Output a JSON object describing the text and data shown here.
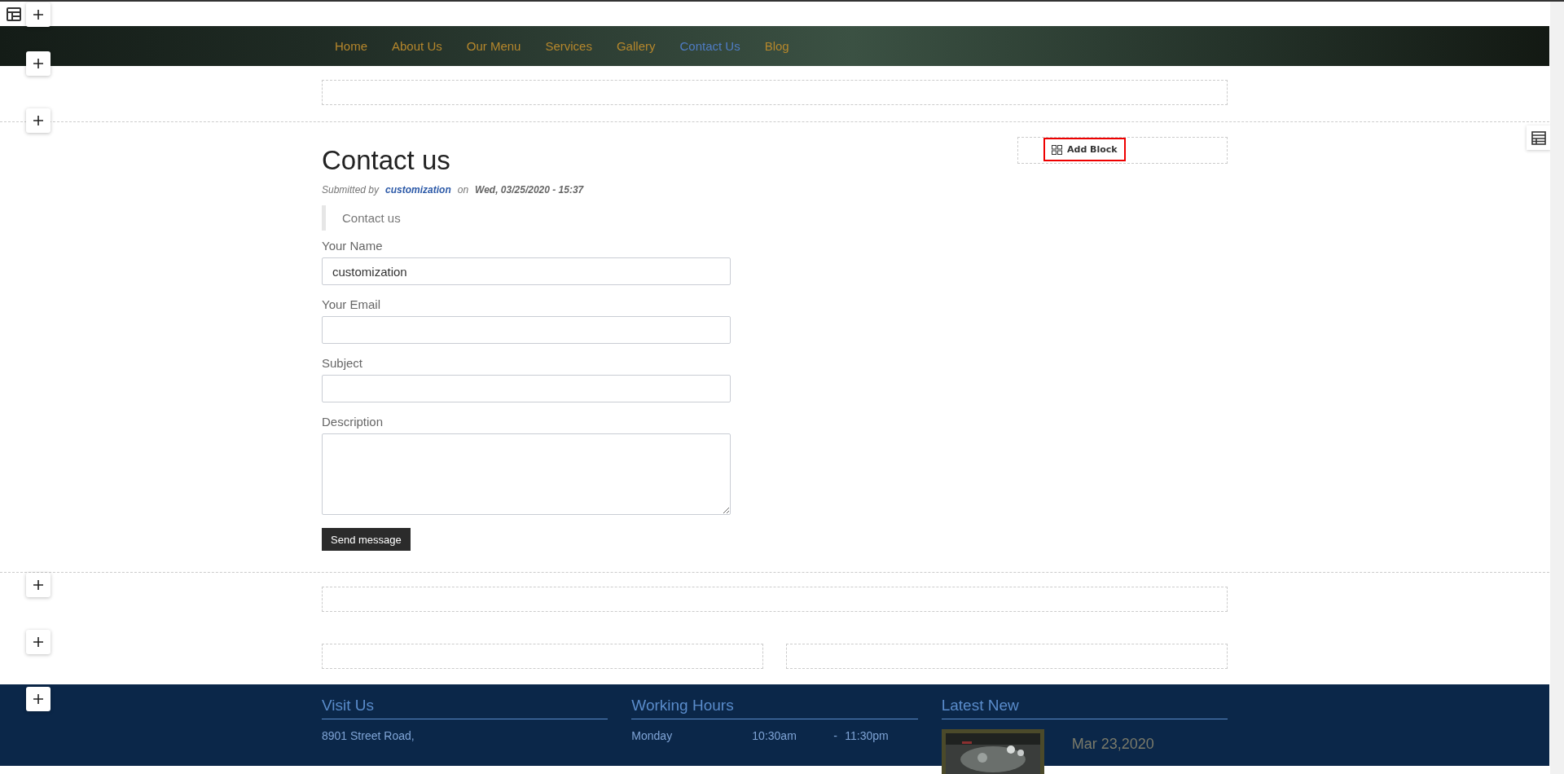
{
  "nav": {
    "items": [
      {
        "label": "Home",
        "selected": false
      },
      {
        "label": "About Us",
        "selected": false
      },
      {
        "label": "Our Menu",
        "selected": false
      },
      {
        "label": "Services",
        "selected": false
      },
      {
        "label": "Gallery",
        "selected": false
      },
      {
        "label": "Contact Us",
        "selected": true
      },
      {
        "label": "Blog",
        "selected": false
      }
    ]
  },
  "add_block": {
    "label": "Add Block"
  },
  "article": {
    "title": "Contact us",
    "submitted_by": "Submitted by",
    "author": "customization",
    "on": "on",
    "date": "Wed, 03/25/2020 - 15:37",
    "quote": "Contact us"
  },
  "form": {
    "fields": [
      {
        "label": "Your Name",
        "kind": "text",
        "value": "customization"
      },
      {
        "label": "Your Email",
        "kind": "text"
      },
      {
        "label": "Subject",
        "kind": "text"
      },
      {
        "label": "Description",
        "kind": "textarea"
      }
    ],
    "submit": "Send message"
  },
  "footer": {
    "visit_us": {
      "title": "Visit Us",
      "lines": [
        "8901 Street Road,"
      ]
    },
    "working_hours": {
      "title": "Working Hours",
      "rows": [
        {
          "day": "Monday",
          "open": "10:30am",
          "separator": "-",
          "close": "11:30pm"
        }
      ]
    },
    "latest_news": {
      "title": "Latest New",
      "items": [
        {
          "kind": "picture",
          "date": "Mar 23,2020"
        }
      ]
    }
  }
}
